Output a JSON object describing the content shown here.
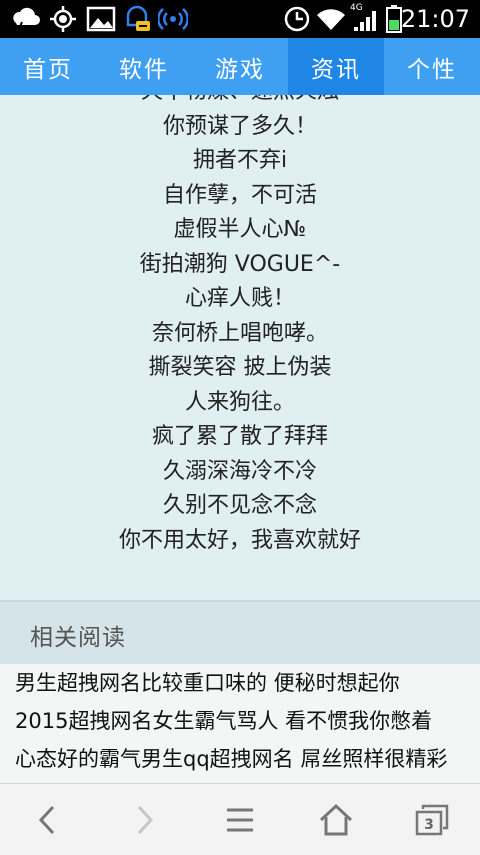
{
  "status_bar": {
    "time": "21:07",
    "network_label": "4G",
    "icons": [
      "weather-icon",
      "gps-icon",
      "image-icon",
      "message-icon",
      "hotspot-icon",
      "alarm-icon",
      "wifi-icon",
      "signal-icon",
      "battery-icon"
    ]
  },
  "nav": {
    "tabs": [
      {
        "label": "首页"
      },
      {
        "label": "软件"
      },
      {
        "label": "游戏"
      },
      {
        "label": "资讯",
        "active": true
      },
      {
        "label": "个性"
      }
    ]
  },
  "article": {
    "lines": [
      "天干物燥、速点火烛",
      "你预谋了多久！",
      "拥者不弃i",
      "自作孽，不可活",
      "虚假半人心№",
      "街拍潮狗 VOGUE^-",
      "心痒人贱！",
      "奈何桥上唱咆哮。",
      "撕裂笑容 披上伪装",
      "人来狗往。",
      "疯了累了散了拜拜",
      "久溺深海冷不冷",
      "久别不见念不念",
      "你不用太好，我喜欢就好"
    ]
  },
  "related": {
    "title": "相关阅读",
    "items": [
      "男生超拽网名比较重口味的 便秘时想起你",
      "2015超拽网名女生霸气骂人 看不惯我你憋着",
      "心态好的霸气男生qq超拽网名 屌丝照样很精彩"
    ]
  },
  "bottom_bar": {
    "tab_count": "3"
  },
  "colors": {
    "nav_bg": "#3f9ff1",
    "nav_active": "#1f86e6",
    "page_bg": "#dfeff2"
  }
}
